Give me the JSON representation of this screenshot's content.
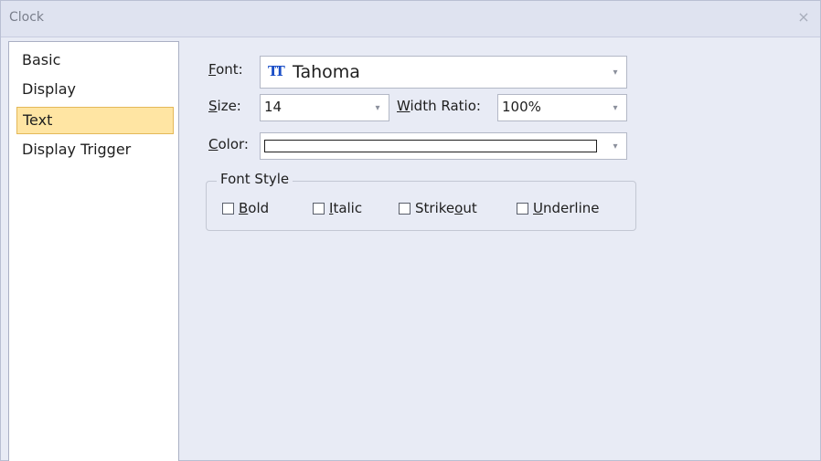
{
  "window": {
    "title": "Clock",
    "close_glyph": "×"
  },
  "nav": {
    "items": [
      {
        "label": "Basic",
        "selected": false
      },
      {
        "label": "Display",
        "selected": false
      },
      {
        "label": "Text",
        "selected": true
      },
      {
        "label": "Display Trigger",
        "selected": false
      }
    ]
  },
  "font": {
    "label_first": "F",
    "label_rest": "ont:",
    "value": "Tahoma",
    "icon": "font-type-icon",
    "icon_glyph": "TT"
  },
  "size": {
    "label_first": "S",
    "label_rest": "ize:",
    "value": "14"
  },
  "width_ratio": {
    "label_first": "W",
    "label_rest": "idth Ratio:",
    "value": "100%"
  },
  "color": {
    "label_first": "C",
    "label_rest": "olor:",
    "value": "#ffffff"
  },
  "font_style": {
    "title": "Font Style",
    "options": [
      {
        "pre": "",
        "acc": "B",
        "post": "old",
        "checked": false
      },
      {
        "pre": "",
        "acc": "I",
        "post": "talic",
        "checked": false
      },
      {
        "pre": "Strike",
        "acc": "o",
        "post": "ut",
        "checked": false
      },
      {
        "pre": "",
        "acc": "U",
        "post": "nderline",
        "checked": false
      }
    ]
  },
  "dropdown_arrow_glyph": "▾"
}
